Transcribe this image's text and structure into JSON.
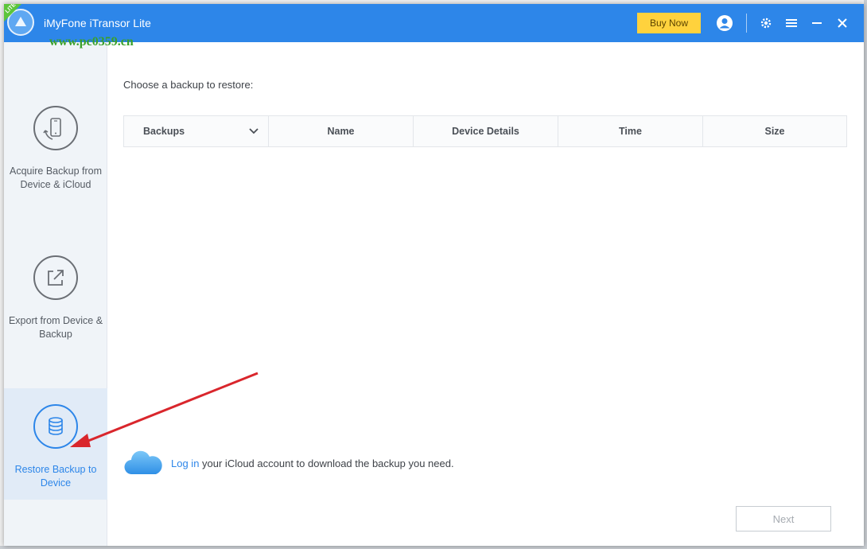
{
  "app": {
    "title": "iMyFone iTransor Lite",
    "badge": "LITE",
    "watermark": "www.pc0359.cn"
  },
  "titlebar": {
    "buy_now": "Buy Now"
  },
  "sidebar": {
    "items": [
      {
        "label": "Acquire Backup from Device & iCloud",
        "icon": "phone-cycle-icon",
        "active": false
      },
      {
        "label": "Export from Device & Backup",
        "icon": "export-icon",
        "active": false
      },
      {
        "label": "Restore Backup to Device",
        "icon": "database-icon",
        "active": true
      }
    ]
  },
  "main": {
    "prompt": "Choose a backup to restore:",
    "columns": [
      "Backups",
      "Name",
      "Device Details",
      "Time",
      "Size"
    ],
    "icloud": {
      "link": "Log in",
      "text": " your iCloud account to download the backup you need."
    },
    "next": "Next"
  },
  "colors": {
    "accent": "#2d86e9",
    "buy": "#ffd23d",
    "annotation_arrow": "#d9262c"
  }
}
